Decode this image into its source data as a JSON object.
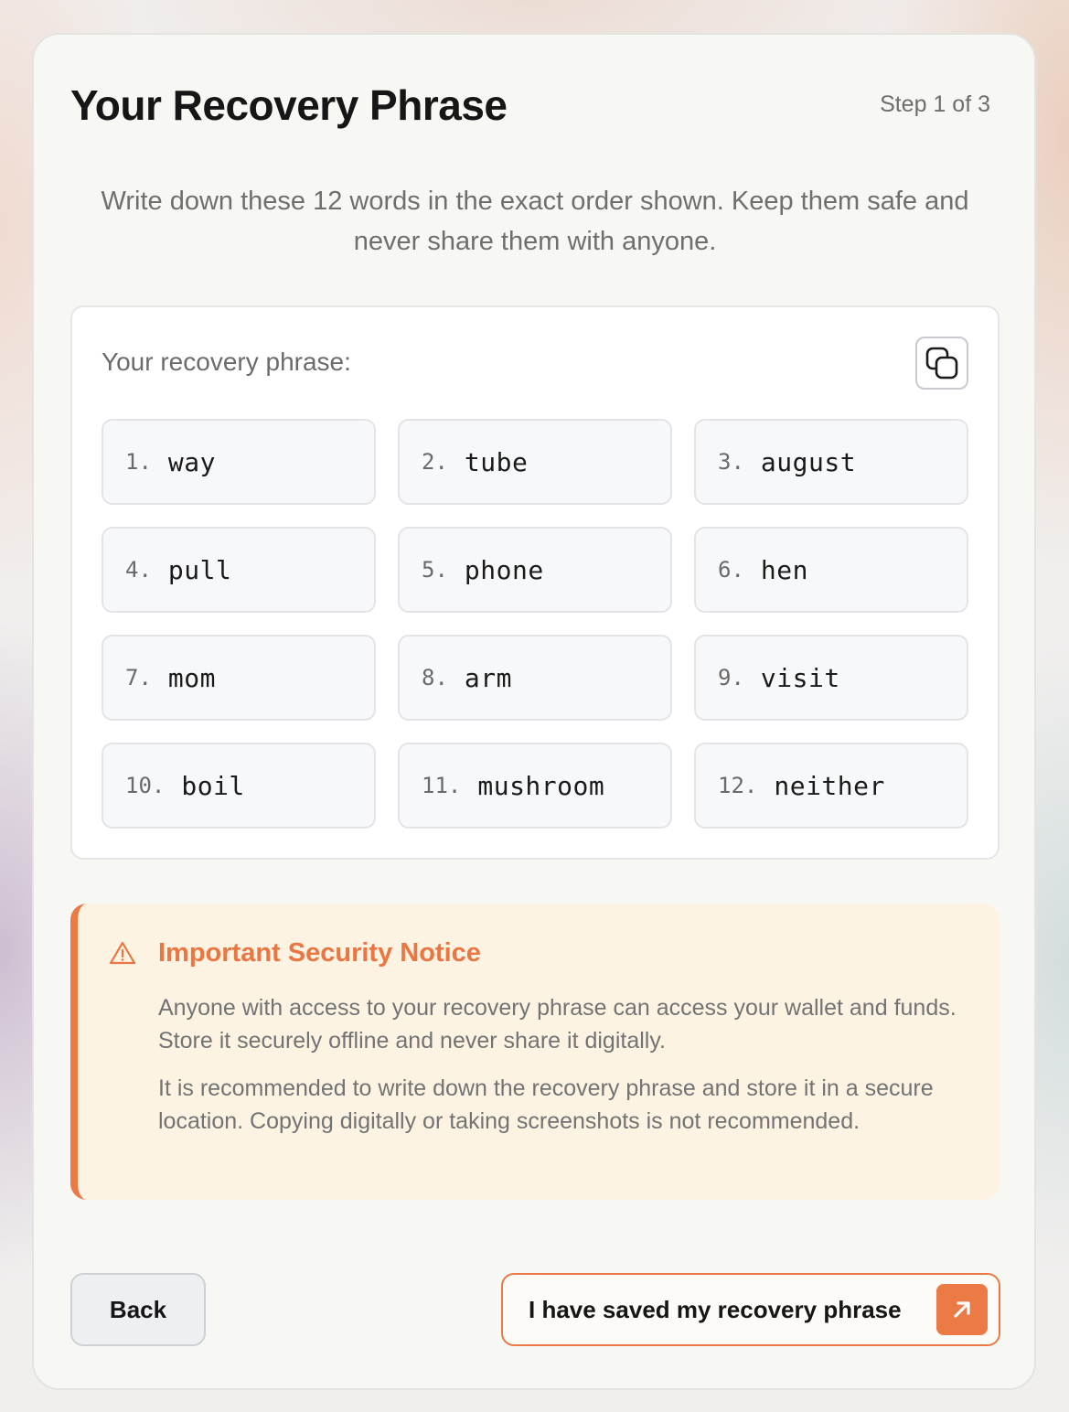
{
  "header": {
    "title": "Your Recovery Phrase",
    "step": "Step 1 of 3"
  },
  "subtitle": "Write down these 12 words in the exact order shown. Keep them safe and never share them with anyone.",
  "phrase": {
    "label": "Your recovery phrase:",
    "copy_icon": "copy-icon",
    "words": [
      {
        "num": "1.",
        "word": "way"
      },
      {
        "num": "2.",
        "word": "tube"
      },
      {
        "num": "3.",
        "word": "august"
      },
      {
        "num": "4.",
        "word": "pull"
      },
      {
        "num": "5.",
        "word": "phone"
      },
      {
        "num": "6.",
        "word": "hen"
      },
      {
        "num": "7.",
        "word": "mom"
      },
      {
        "num": "8.",
        "word": "arm"
      },
      {
        "num": "9.",
        "word": "visit"
      },
      {
        "num": "10.",
        "word": "boil"
      },
      {
        "num": "11.",
        "word": "mushroom"
      },
      {
        "num": "12.",
        "word": "neither"
      }
    ]
  },
  "notice": {
    "icon": "warning-icon",
    "title": "Important Security Notice",
    "paragraph1": "Anyone with access to your recovery phrase can access your wallet and funds. Store it securely offline and never share it digitally.",
    "paragraph2": "It is recommended to write down the recovery phrase and store it in a secure location. Copying digitally or taking screenshots is not recommended."
  },
  "actions": {
    "back_label": "Back",
    "save_label": "I have saved my recovery phrase",
    "save_icon": "arrow-up-right-icon"
  },
  "colors": {
    "accent": "#ec7a45",
    "notice_bg": "#fcf3e3",
    "card_bg": "#f7f7f4"
  }
}
